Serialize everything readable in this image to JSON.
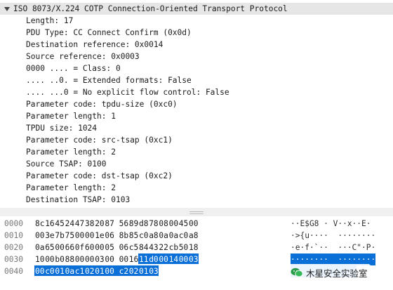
{
  "detail": {
    "cut_line": "...  ..   .. . . .. ...",
    "header": "ISO 8073/X.224 COTP Connection-Oriented Transport Protocol",
    "fields": [
      "Length: 17",
      "PDU Type: CC Connect Confirm (0x0d)",
      "Destination reference: 0x0014",
      "Source reference: 0x0003",
      "0000 .... = Class: 0",
      ".... ..0. = Extended formats: False",
      ".... ...0 = No explicit flow control: False",
      "Parameter code: tpdu-size (0xc0)",
      "Parameter length: 1",
      "TPDU size: 1024",
      "Parameter code: src-tsap (0xc1)",
      "Parameter length: 2",
      "Source TSAP: 0100",
      "Parameter code: dst-tsap (0xc2)",
      "Parameter length: 2",
      "Destination TSAP: 0103"
    ]
  },
  "hex": {
    "rows": [
      {
        "offset": "0000",
        "bytes": [
          "8c",
          "16",
          "45",
          "24",
          "47",
          "38",
          "20",
          "87",
          "56",
          "89",
          "d8",
          "78",
          "08",
          "00",
          "45",
          "00"
        ],
        "highlight_from": 99,
        "ascii": "··E$G8 · V··x··E·",
        "ascii_hl": false
      },
      {
        "offset": "0010",
        "bytes": [
          "00",
          "3e",
          "7b",
          "75",
          "00",
          "00",
          "1e",
          "06",
          "8b",
          "85",
          "c0",
          "a8",
          "0a",
          "0a",
          "c0",
          "a8"
        ],
        "highlight_from": 99,
        "ascii": "·>{u····  ········",
        "ascii_hl": false
      },
      {
        "offset": "0020",
        "bytes": [
          "0a",
          "65",
          "00",
          "66",
          "0f",
          "60",
          "00",
          "05",
          "06",
          "c5",
          "84",
          "43",
          "22",
          "cb",
          "50",
          "18"
        ],
        "highlight_from": 99,
        "ascii": "·e·f·`··  ···C\"·P·",
        "ascii_hl": false
      },
      {
        "offset": "0030",
        "bytes": [
          "10",
          "00",
          "b0",
          "88",
          "00",
          "00",
          "03",
          "00",
          "00",
          "16",
          "11",
          "d0",
          "00",
          "14",
          "00",
          "03"
        ],
        "highlight_from": 10,
        "ascii": "········  ········",
        "ascii_hl": true
      },
      {
        "offset": "0040",
        "bytes": [
          "00",
          "c0",
          "01",
          "0a",
          "c1",
          "02",
          "01",
          "00",
          "c2",
          "02",
          "01",
          "03"
        ],
        "highlight_from": 0,
        "ascii": "········  ····",
        "ascii_hl": true
      }
    ]
  },
  "watermark": {
    "text": "木星安全实验室",
    "logo_icon": "wechat-icon"
  }
}
